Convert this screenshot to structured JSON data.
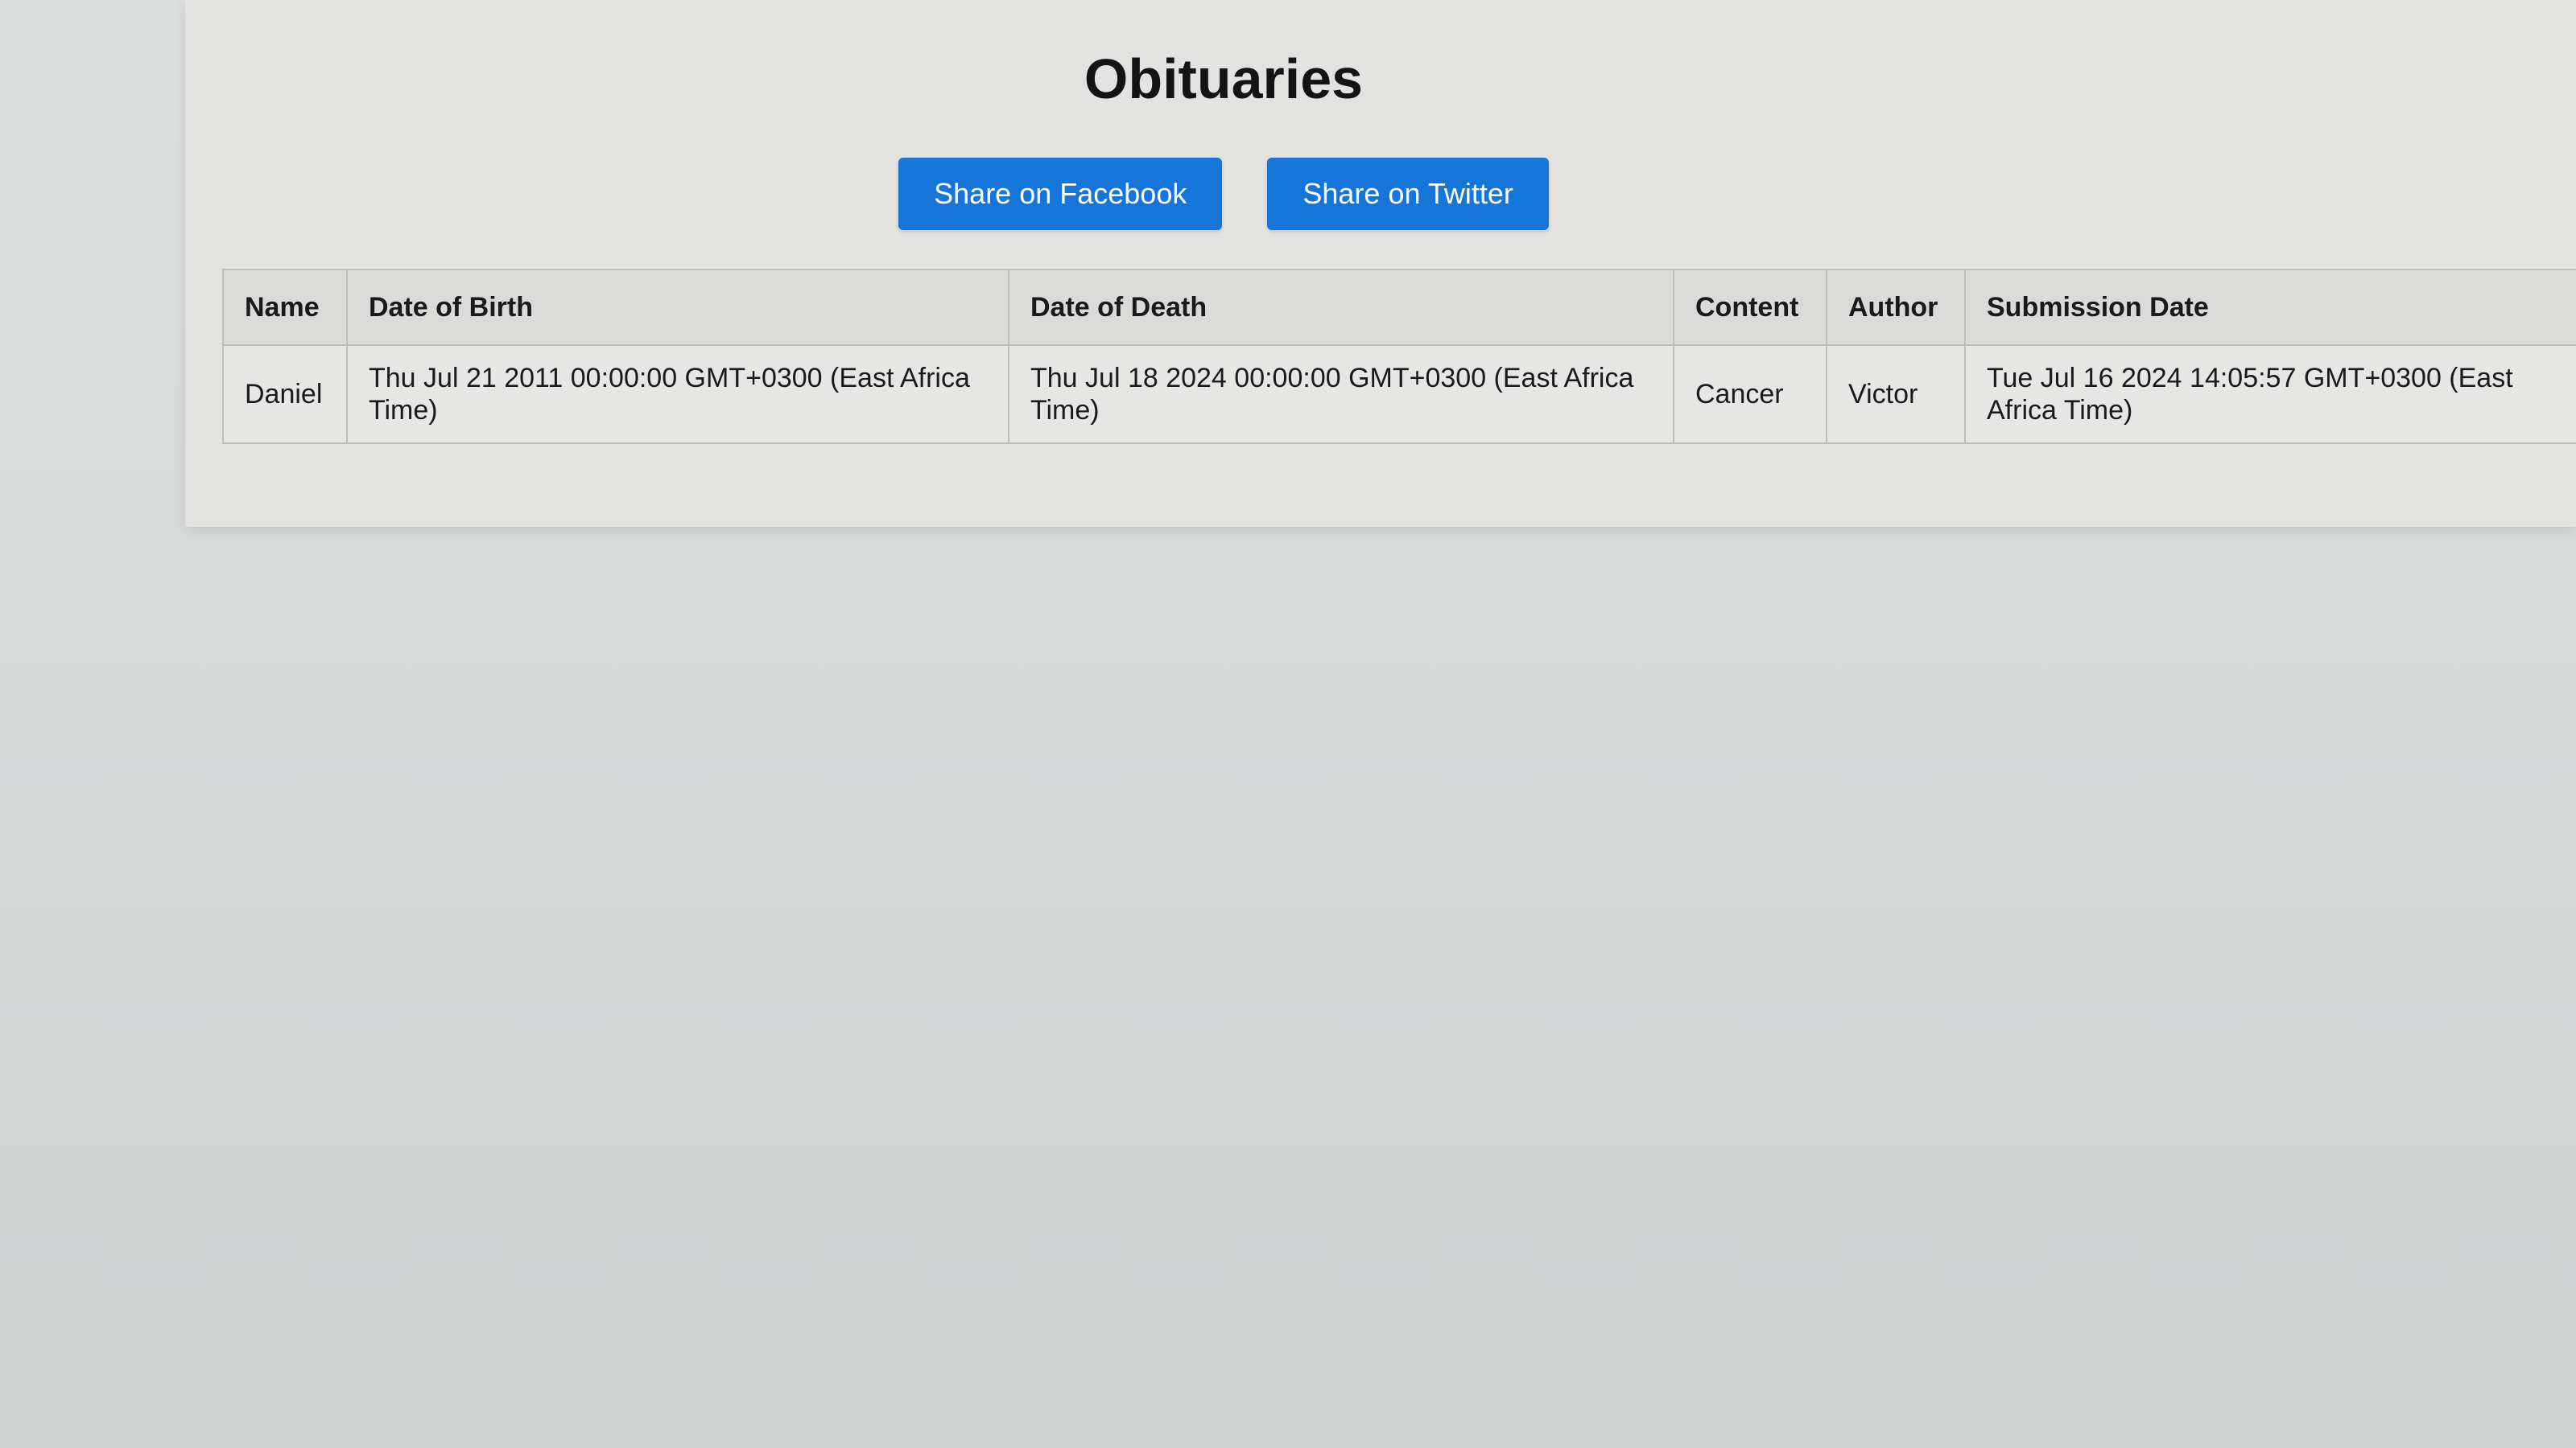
{
  "page": {
    "title": "Obituaries"
  },
  "share": {
    "facebook_label": "Share on Facebook",
    "twitter_label": "Share on Twitter",
    "button_color": "#1575d8"
  },
  "table": {
    "headers": {
      "name": "Name",
      "date_of_birth": "Date of Birth",
      "date_of_death": "Date of Death",
      "content": "Content",
      "author": "Author",
      "submission_date": "Submission Date"
    },
    "rows": [
      {
        "name": "Daniel",
        "date_of_birth": "Thu Jul 21 2011 00:00:00 GMT+0300 (East Africa Time)",
        "date_of_death": "Thu Jul 18 2024 00:00:00 GMT+0300 (East Africa Time)",
        "content": "Cancer",
        "author": "Victor",
        "submission_date": "Tue Jul 16 2024 14:05:57 GMT+0300 (East Africa Time)"
      }
    ]
  }
}
